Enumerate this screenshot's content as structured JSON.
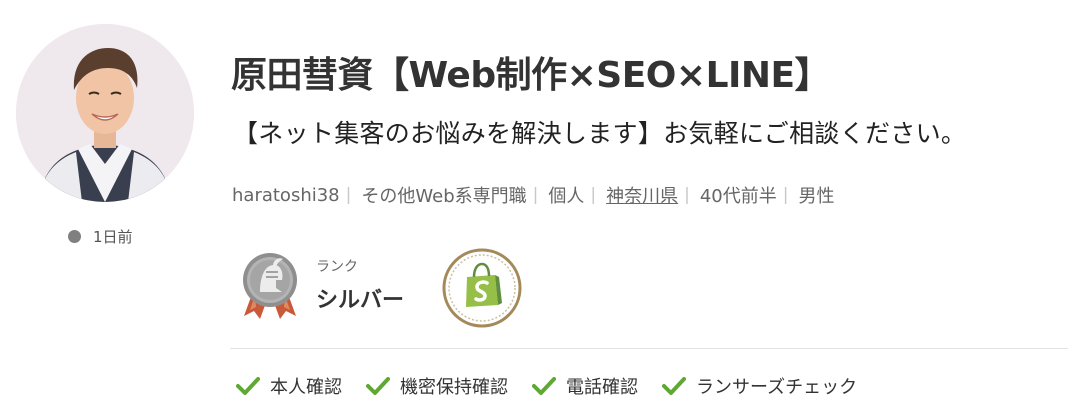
{
  "profile": {
    "name": "原田彗資【Web制作×SEO×LINE】",
    "catchphrase": "【ネット集客のお悩みを解決します】お気軽にご相談ください。",
    "last_login": "1日前"
  },
  "meta": {
    "username": "haratoshi38",
    "occupation": "その他Web系専門職",
    "type": "個人",
    "location": "神奈川県",
    "age": "40代前半",
    "gender": "男性",
    "separator": "|"
  },
  "rank": {
    "label": "ランク",
    "value": "シルバー",
    "icon": "silver-rank-medal-icon"
  },
  "skill_badge": {
    "icon": "shopify-bag-icon"
  },
  "verifications": {
    "items": [
      "本人確認",
      "機密保持確認",
      "電話確認",
      "ランサーズチェック"
    ],
    "icon": "check-icon",
    "color": "#5fa833"
  },
  "colors": {
    "status_dot": "#808080",
    "badge_ring": "#a48a5a",
    "shopify_green": "#95bf47",
    "medal_gray": "#9a9a9a",
    "ribbon": "#c85a3a"
  }
}
